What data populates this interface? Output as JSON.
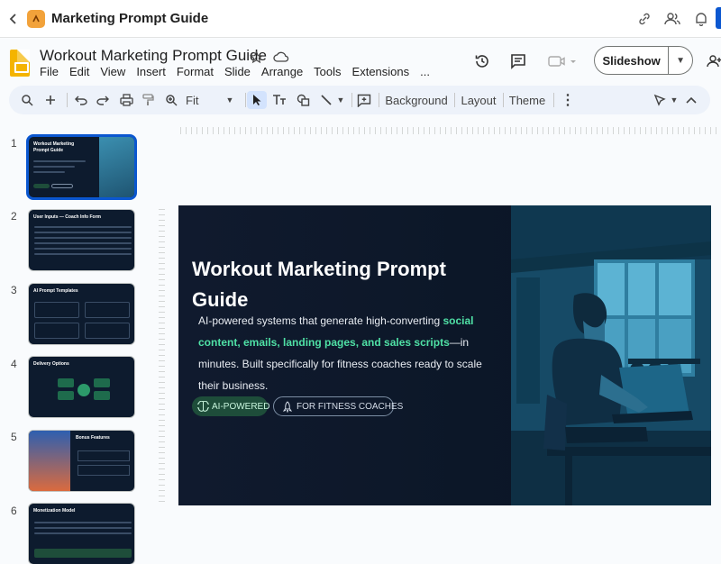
{
  "tab": {
    "title": "Marketing Prompt Guide"
  },
  "header": {
    "doc_title": "Workout Marketing Prompt Guide",
    "menus": [
      "File",
      "Edit",
      "View",
      "Insert",
      "Format",
      "Slide",
      "Arrange",
      "Tools",
      "Extensions",
      "..."
    ],
    "slideshow_label": "Slideshow"
  },
  "toolbar": {
    "zoom_label": "Fit",
    "background_label": "Background",
    "layout_label": "Layout",
    "theme_label": "Theme"
  },
  "filmstrip": {
    "slides": [
      {
        "number": "1",
        "title": "Workout Marketing Prompt Guide"
      },
      {
        "number": "2",
        "title": "User Inputs — Coach Info Form"
      },
      {
        "number": "3",
        "title": "AI Prompt Templates"
      },
      {
        "number": "4",
        "title": "Delivery Options"
      },
      {
        "number": "5",
        "title": "Bonus Features"
      },
      {
        "number": "6",
        "title": "Monetization Model"
      }
    ]
  },
  "slide": {
    "title": "Workout Marketing Prompt Guide",
    "desc_part1": "AI-powered systems that generate high-converting ",
    "desc_highlight": "social content, emails, landing pages, and sales scripts",
    "desc_part2": "—in minutes. Built specifically for fitness coaches ready to scale their business.",
    "pill_ai": "AI-POWERED",
    "pill_fitness": "FOR FITNESS COACHES"
  },
  "colors": {
    "accent": "#0b57d0",
    "highlight_green": "#4fe0a5",
    "slide_bg": "#101a2e"
  }
}
